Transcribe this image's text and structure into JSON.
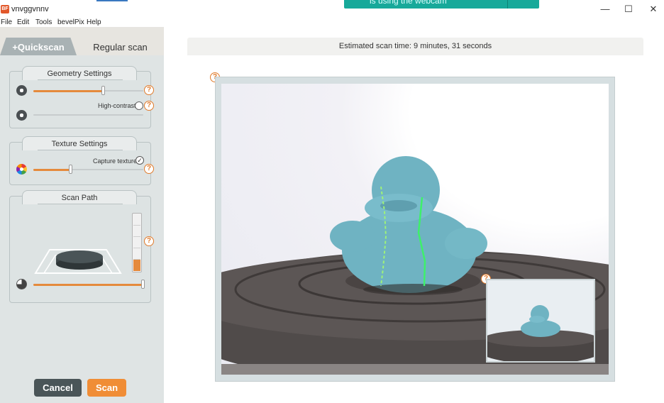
{
  "window": {
    "title": "vnvggvnnv",
    "app_icon_text": "BF",
    "toast_text": "is using the webcam",
    "minimize": "—",
    "maximize": "☐",
    "close": "✕"
  },
  "menu": {
    "items": [
      "File",
      "Edit",
      "Tools",
      "bevelPix",
      "Help"
    ]
  },
  "tabs": {
    "quickscan": "+Quickscan",
    "regular": "Regular scan"
  },
  "geometry": {
    "title": "Geometry Settings",
    "slider1_value": 0.64,
    "slider2_value": 0.0,
    "high_contrast_label": "High-contrast"
  },
  "texture": {
    "title": "Texture Settings",
    "capture_label": "Capture texture",
    "capture_check": "✓",
    "slider_value": 0.34
  },
  "scan_path": {
    "title": "Scan Path",
    "rotation_value": 1.0
  },
  "help_glyph": "?",
  "buttons": {
    "cancel": "Cancel",
    "scan": "Scan"
  },
  "status": {
    "estimated": "Estimated scan time: 9 minutes, 31 seconds"
  },
  "colors": {
    "accent": "#e58a3c",
    "cancel_bg": "#4a5558",
    "scan_bg": "#f08d36",
    "toast": "#17a99a",
    "duck": "#6fb3c2"
  }
}
